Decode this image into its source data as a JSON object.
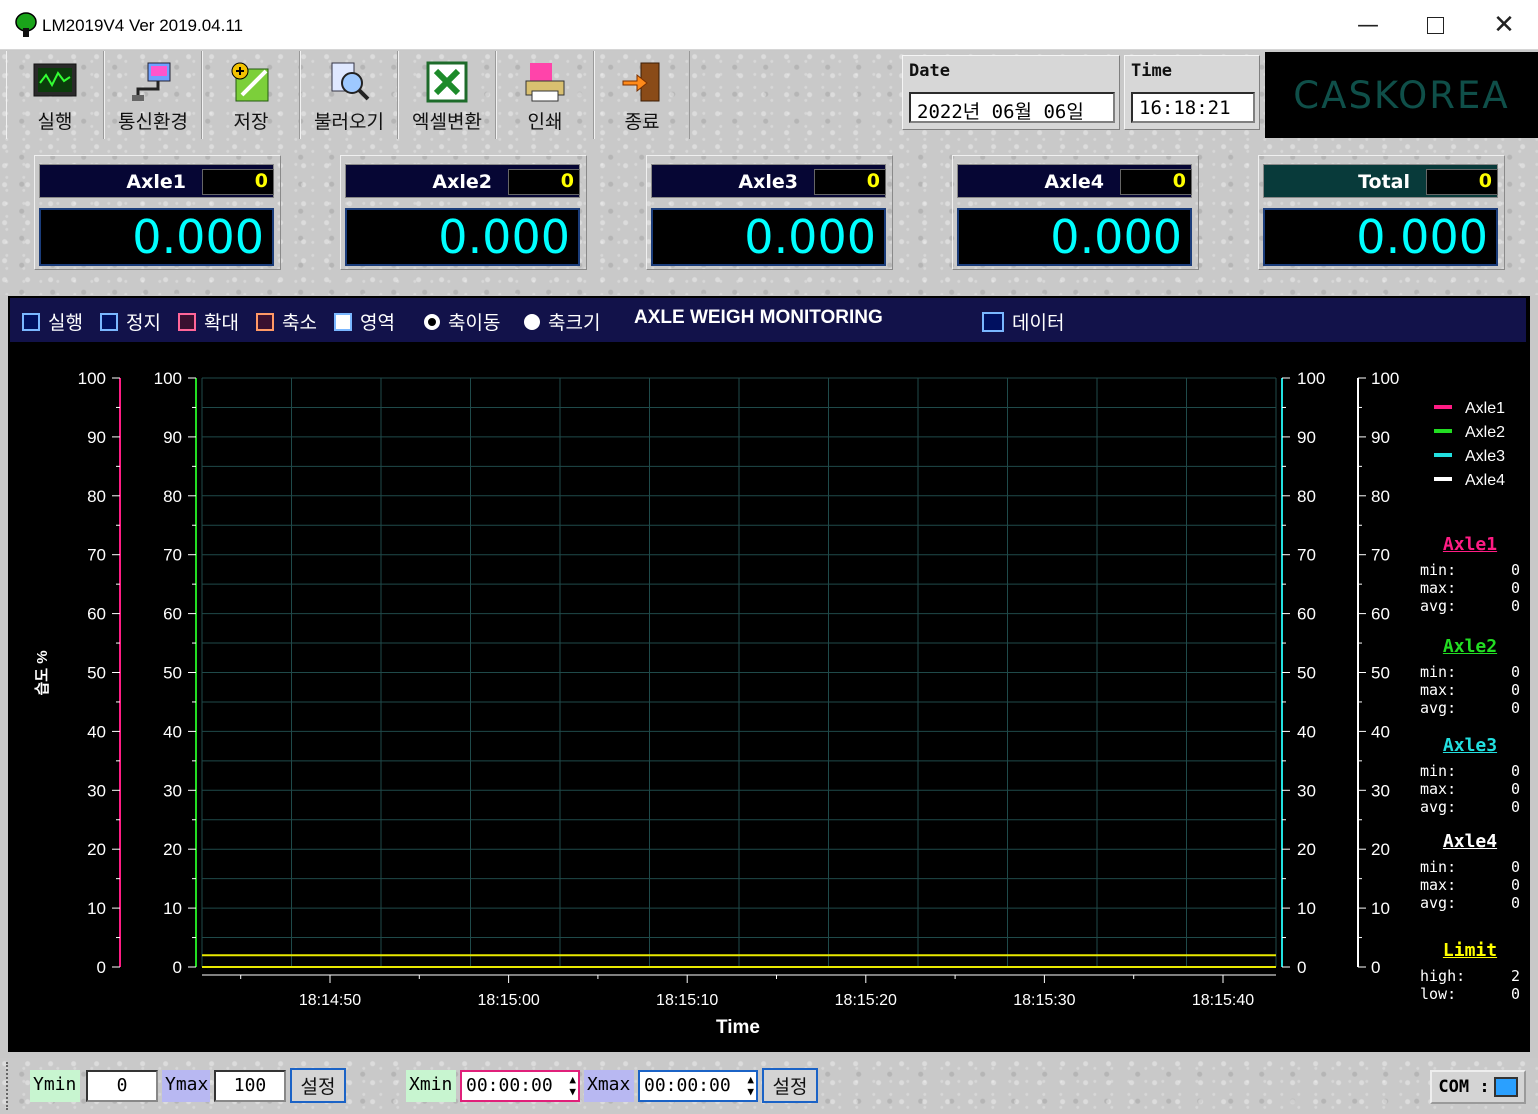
{
  "window": {
    "title": "LM2019V4  Ver 2019.04.11"
  },
  "toolbar": {
    "run": "실행",
    "comm_settings": "통신환경",
    "save": "저장",
    "load": "불러오기",
    "excel_convert": "엑셀변환",
    "print": "인쇄",
    "exit": "종료"
  },
  "datetime": {
    "date_label": "Date",
    "date_value": "2022년  06월  06일",
    "time_label": "Time",
    "time_value": "16:18:21"
  },
  "brand": "CASKOREA",
  "axles": [
    {
      "name": "Axle1",
      "count": "0",
      "value": "0.000"
    },
    {
      "name": "Axle2",
      "count": "0",
      "value": "0.000"
    },
    {
      "name": "Axle3",
      "count": "0",
      "value": "0.000"
    },
    {
      "name": "Axle4",
      "count": "0",
      "value": "0.000"
    },
    {
      "name": "Total",
      "count": "0",
      "value": "0.000"
    }
  ],
  "graph_toolbar": {
    "run": "실행",
    "stop": "정지",
    "zoom_in": "확대",
    "zoom_out": "축소",
    "area": "영역",
    "axis_move": "축이동",
    "axis_size": "축크기",
    "title": "AXLE WEIGH MONITORING",
    "data": "데이터"
  },
  "chart_data": {
    "type": "line",
    "title": "AXLE WEIGH MONITORING",
    "xlabel": "Time",
    "ylabel": "습도 %",
    "ylim": [
      0,
      100
    ],
    "yticks": [
      0,
      10,
      20,
      30,
      40,
      50,
      60,
      70,
      80,
      90,
      100
    ],
    "x_ticks": [
      "18:14:50",
      "18:15:00",
      "18:15:10",
      "18:15:20",
      "18:15:30",
      "18:15:40"
    ],
    "grid": true,
    "legend_position": "top-right",
    "series": [
      {
        "name": "Axle1",
        "color": "#ff1c84",
        "values": []
      },
      {
        "name": "Axle2",
        "color": "#22dd22",
        "values": []
      },
      {
        "name": "Axle3",
        "color": "#22e0e0",
        "values": []
      },
      {
        "name": "Axle4",
        "color": "#ffffff",
        "values": []
      }
    ],
    "limit_lines": {
      "high": 2,
      "low": 0,
      "color": "#e8e800"
    }
  },
  "stats": {
    "min_label": "min:",
    "max_label": "max:",
    "avg_label": "avg:",
    "high_label": "high:",
    "low_label": "low:",
    "axle1": {
      "title": "Axle1",
      "min": "0",
      "max": "0",
      "avg": "0"
    },
    "axle2": {
      "title": "Axle2",
      "min": "0",
      "max": "0",
      "avg": "0"
    },
    "axle3": {
      "title": "Axle3",
      "min": "0",
      "max": "0",
      "avg": "0"
    },
    "axle4": {
      "title": "Axle4",
      "min": "0",
      "max": "0",
      "avg": "0"
    },
    "limit": {
      "title": "Limit",
      "high": "2",
      "low": "0"
    }
  },
  "bottom": {
    "ymin_label": "Ymin",
    "ymin_value": "0",
    "ymax_label": "Ymax",
    "ymax_value": "100",
    "set_y": "설정",
    "xmin_label": "Xmin",
    "xmin_value": "00:00:00",
    "xmax_label": "Xmax",
    "xmax_value": "00:00:00",
    "set_x": "설정",
    "com_label": "COM :"
  }
}
